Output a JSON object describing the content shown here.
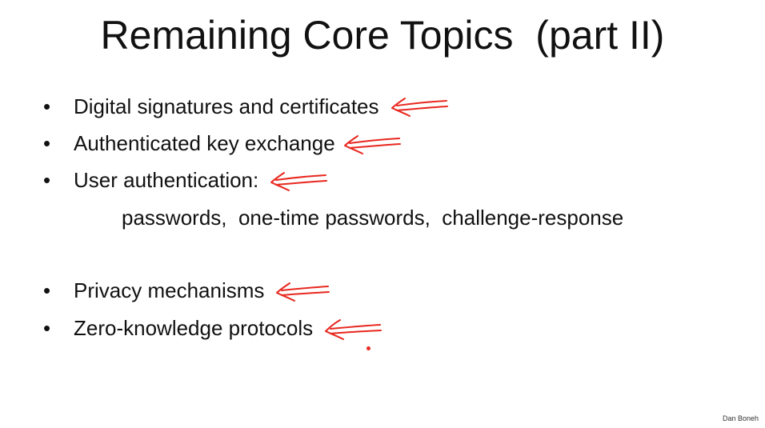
{
  "slide": {
    "title": "Remaining Core Topics  (part II)",
    "bullet_glyph": "•",
    "bullets": [
      {
        "text": "Digital signatures and certificates",
        "marked": true
      },
      {
        "text": "Authenticated key exchange",
        "marked": true
      },
      {
        "text": "User authentication:",
        "marked": true
      },
      {
        "text": "Privacy mechanisms",
        "marked": true
      },
      {
        "text": "Zero-knowledge protocols",
        "marked": true
      }
    ],
    "sub_item": "passwords,  one-time passwords,  challenge-response",
    "footer": "Dan Boneh"
  },
  "annotations": {
    "ink_color": "#e8271e",
    "arrow_icon": "left-arrow-icon"
  }
}
